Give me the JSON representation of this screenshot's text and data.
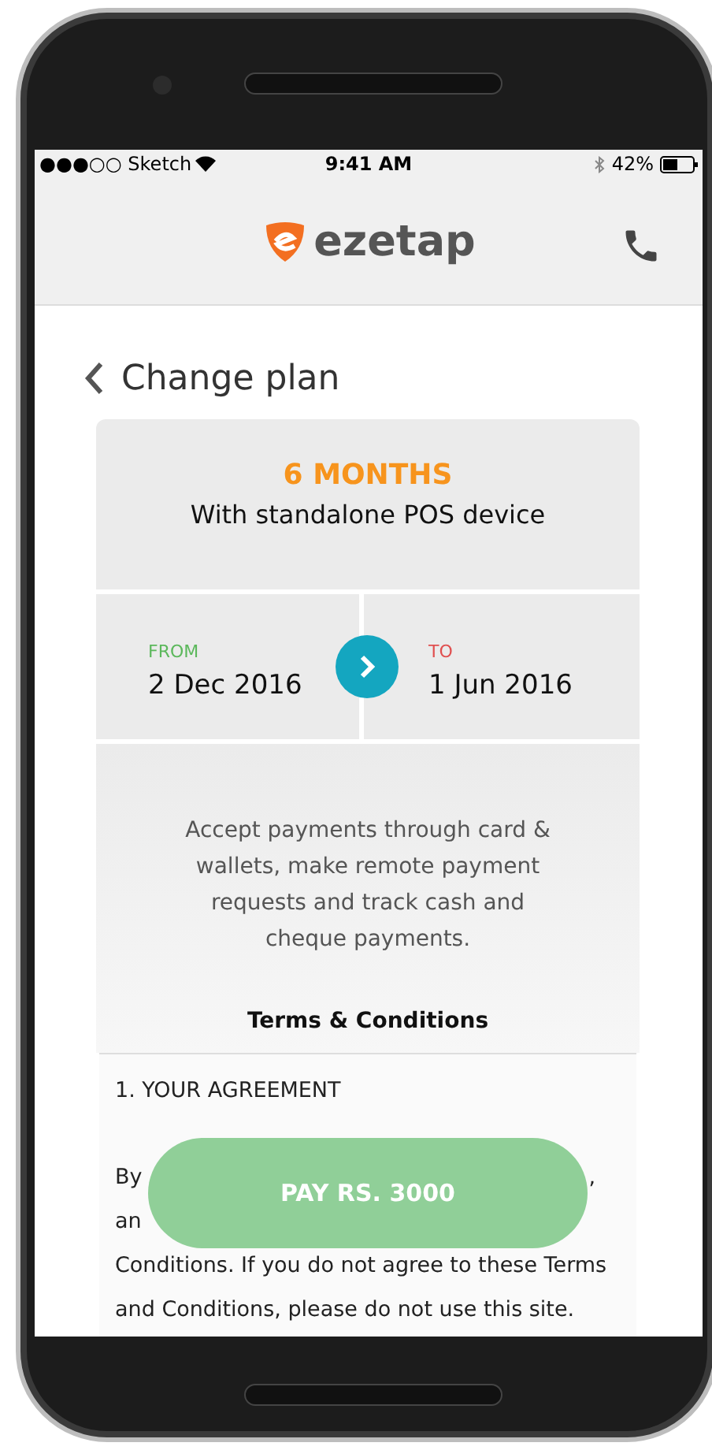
{
  "status_bar": {
    "carrier": "●●●○○ Sketch",
    "time": "9:41 AM",
    "battery": "42%"
  },
  "header": {
    "logo_text": "ezetap"
  },
  "page": {
    "back_title": "Change plan"
  },
  "plan": {
    "duration": "6 MONTHS",
    "subtitle": "With standalone POS device",
    "from_label": "FROM",
    "from_date": "2 Dec 2016",
    "to_label": "TO",
    "to_date": "1 Jun 2016",
    "description": "Accept payments  through card & wallets, make remote payment requests and track cash and cheque payments."
  },
  "terms": {
    "title": "Terms & Conditions",
    "section": "1. YOUR AGREEMENT",
    "lines": [
      {
        "left": "By",
        "right": ","
      },
      {
        "left": "an"
      },
      {
        "left": "Conditions. If you do not agree to these Terms"
      },
      {
        "left": "and Conditions, please do not use this site."
      }
    ]
  },
  "pay_button": {
    "label": "PAY RS. 3000"
  }
}
